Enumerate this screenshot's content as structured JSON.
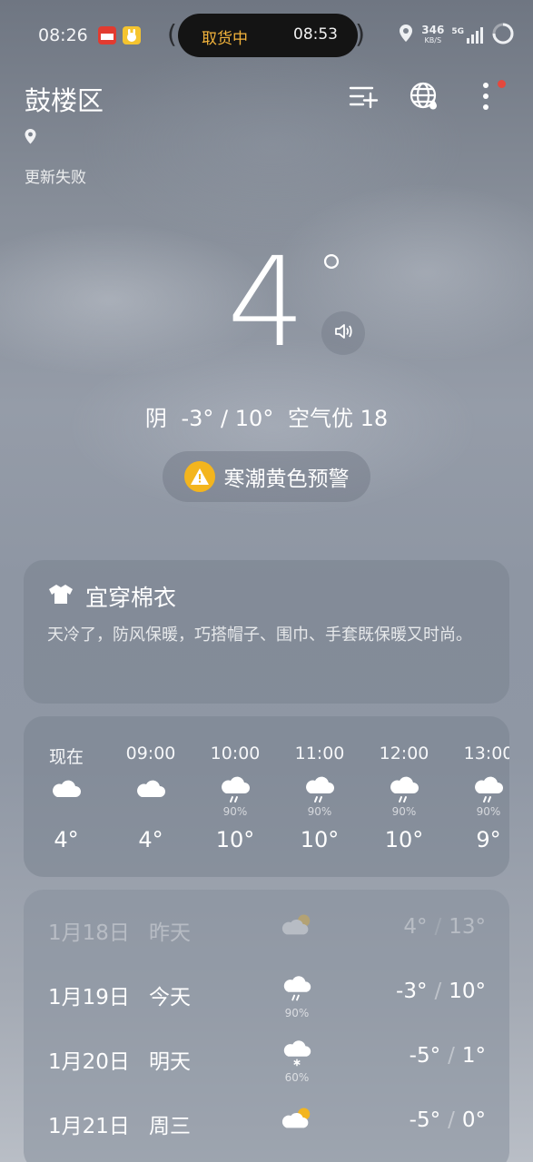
{
  "status_bar": {
    "time": "08:26",
    "island_label": "取货中",
    "island_time": "08:53",
    "net_speed": "346",
    "net_unit": "KB/S",
    "net_type": "5G"
  },
  "header": {
    "city": "鼓楼区",
    "update_status": "更新失败",
    "icons": [
      "add-city-icon",
      "globe-icon",
      "more-icon"
    ]
  },
  "current": {
    "temperature": "4",
    "degree": "°",
    "condition": "阴",
    "range": "-3° / 10°",
    "air_quality": "空气优 18",
    "warning": "寒潮黄色预警"
  },
  "dressing": {
    "title": "宜穿棉衣",
    "description": "天冷了，防风保暖，巧搭帽子、围巾、手套既保暖又时尚。"
  },
  "hourly": [
    {
      "time": "现在",
      "icon": "cloud-icon",
      "precip": "",
      "temp": "4°"
    },
    {
      "time": "09:00",
      "icon": "cloud-icon",
      "precip": "",
      "temp": "4°"
    },
    {
      "time": "10:00",
      "icon": "rain-icon",
      "precip": "90%",
      "temp": "10°"
    },
    {
      "time": "11:00",
      "icon": "rain-icon",
      "precip": "90%",
      "temp": "10°"
    },
    {
      "time": "12:00",
      "icon": "rain-icon",
      "precip": "90%",
      "temp": "10°"
    },
    {
      "time": "13:00",
      "icon": "rain-icon",
      "precip": "90%",
      "temp": "9°"
    }
  ],
  "daily": [
    {
      "date": "1月18日",
      "day": "昨天",
      "icon": "partly-cloudy-icon",
      "precip": "",
      "low": "4°",
      "high": "13°"
    },
    {
      "date": "1月19日",
      "day": "今天",
      "icon": "rain-icon",
      "precip": "90%",
      "low": "-3°",
      "high": "10°"
    },
    {
      "date": "1月20日",
      "day": "明天",
      "icon": "snow-icon",
      "precip": "60%",
      "low": "-5°",
      "high": "1°"
    },
    {
      "date": "1月21日",
      "day": "周三",
      "icon": "partly-cloudy-icon",
      "precip": "",
      "low": "-5°",
      "high": "0°"
    }
  ],
  "colors": {
    "warning_yellow": "#f3b51e",
    "island_label": "#f4b43c",
    "notification_dot": "#e5483d"
  }
}
